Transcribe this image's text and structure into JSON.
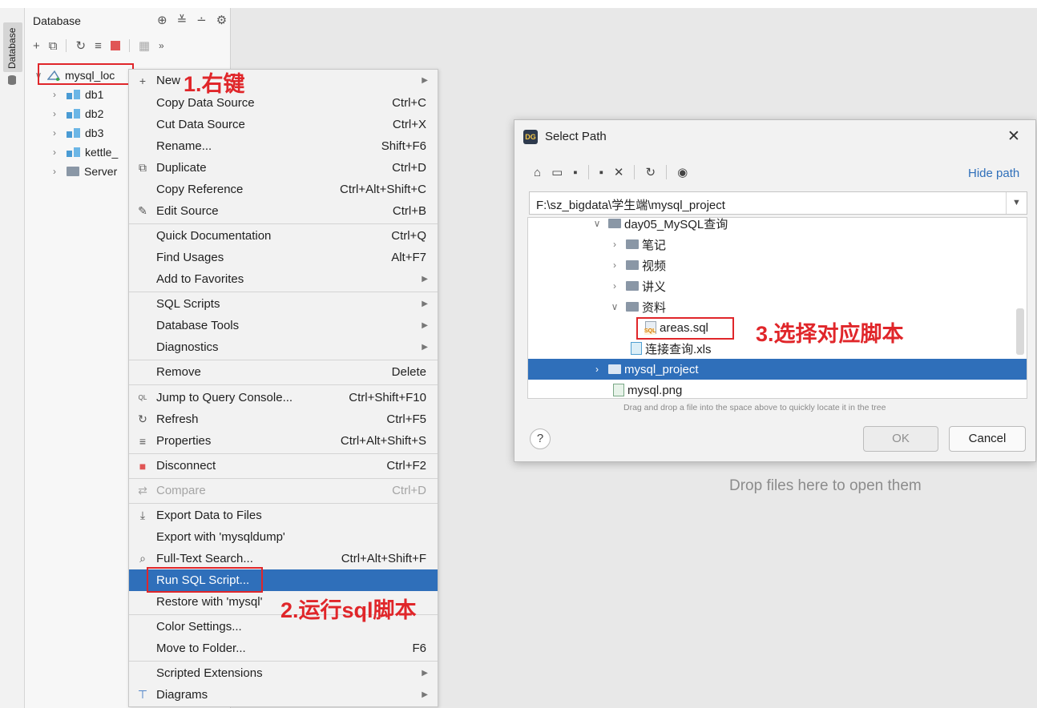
{
  "left_stripe": {
    "tab_label": "Database"
  },
  "panel": {
    "title": "Database"
  },
  "tree": [
    {
      "label": "mysql_loc",
      "icon": "mysql-connection-icon"
    },
    {
      "label": "db1",
      "icon": "database-icon"
    },
    {
      "label": "db2",
      "icon": "database-icon"
    },
    {
      "label": "db3",
      "icon": "database-icon"
    },
    {
      "label": "kettle_",
      "icon": "database-icon"
    },
    {
      "label": "Server",
      "icon": "folder-icon"
    }
  ],
  "context_menu": {
    "items": [
      {
        "icon": "+",
        "label": "New",
        "shortcut": "",
        "submenu": true
      },
      {
        "icon": "",
        "label": "Copy Data Source",
        "shortcut": "Ctrl+C"
      },
      {
        "icon": "",
        "label": "Cut Data Source",
        "shortcut": "Ctrl+X"
      },
      {
        "icon": "",
        "label": "Rename...",
        "shortcut": "Shift+F6"
      },
      {
        "icon": "⧉",
        "label": "Duplicate",
        "shortcut": "Ctrl+D"
      },
      {
        "icon": "",
        "label": "Copy Reference",
        "shortcut": "Ctrl+Alt+Shift+C"
      },
      {
        "icon": "✎",
        "label": "Edit Source",
        "shortcut": "Ctrl+B"
      },
      {
        "icon": "",
        "label": "Quick Documentation",
        "shortcut": "Ctrl+Q"
      },
      {
        "icon": "",
        "label": "Find Usages",
        "shortcut": "Alt+F7"
      },
      {
        "icon": "",
        "label": "Add to Favorites",
        "shortcut": "",
        "submenu": true
      },
      {
        "icon": "",
        "label": "SQL Scripts",
        "shortcut": "",
        "submenu": true
      },
      {
        "icon": "",
        "label": "Database Tools",
        "shortcut": "",
        "submenu": true
      },
      {
        "icon": "",
        "label": "Diagnostics",
        "shortcut": "",
        "submenu": true
      },
      {
        "icon": "",
        "label": "Remove",
        "shortcut": "Delete"
      },
      {
        "icon": "QL",
        "label": "Jump to Query Console...",
        "shortcut": "Ctrl+Shift+F10"
      },
      {
        "icon": "↻",
        "label": "Refresh",
        "shortcut": "Ctrl+F5"
      },
      {
        "icon": "≡",
        "label": "Properties",
        "shortcut": "Ctrl+Alt+Shift+S"
      },
      {
        "icon": "■",
        "label": "Disconnect",
        "shortcut": "Ctrl+F2"
      },
      {
        "icon": "⇄",
        "label": "Compare",
        "shortcut": "Ctrl+D",
        "disabled": true
      },
      {
        "icon": "⤓",
        "label": "Export Data to Files",
        "shortcut": ""
      },
      {
        "icon": "",
        "label": "Export with 'mysqldump'",
        "shortcut": ""
      },
      {
        "icon": "⌕",
        "label": "Full-Text Search...",
        "shortcut": "Ctrl+Alt+Shift+F"
      },
      {
        "icon": "",
        "label": "Run SQL Script...",
        "shortcut": "",
        "selected": true
      },
      {
        "icon": "",
        "label": "Restore with 'mysql'",
        "shortcut": ""
      },
      {
        "icon": "",
        "label": "Color Settings...",
        "shortcut": ""
      },
      {
        "icon": "",
        "label": "Move to Folder...",
        "shortcut": "F6"
      },
      {
        "icon": "",
        "label": "Scripted Extensions",
        "shortcut": "",
        "submenu": true
      },
      {
        "icon": "⊤",
        "label": "Diagrams",
        "shortcut": "",
        "submenu": true
      }
    ]
  },
  "annotations": {
    "step1": "1.右键",
    "step2": "2.运行sql脚本",
    "step3": "3.选择对应脚本"
  },
  "dialog": {
    "title": "Select Path",
    "logo": "DG",
    "hide_path": "Hide path",
    "path_value": "F:\\sz_bigdata\\学生端\\mysql_project",
    "tree": [
      {
        "label": "day05_MySQL查询",
        "type": "folder",
        "chevron": "open"
      },
      {
        "label": "笔记",
        "type": "folder",
        "chevron": "closed"
      },
      {
        "label": "视频",
        "type": "folder",
        "chevron": "closed"
      },
      {
        "label": "讲义",
        "type": "folder",
        "chevron": "closed"
      },
      {
        "label": "资料",
        "type": "folder",
        "chevron": "open"
      },
      {
        "label": "areas.sql",
        "type": "sql",
        "chevron": ""
      },
      {
        "label": "连接查询.xls",
        "type": "xls",
        "chevron": ""
      },
      {
        "label": "mysql_project",
        "type": "folder",
        "chevron": "closed",
        "selected": true
      },
      {
        "label": "mysql.png",
        "type": "png",
        "chevron": ""
      }
    ],
    "hint": "Drag and drop a file into the space above to quickly locate it in the tree",
    "help_label": "?",
    "ok_label": "OK",
    "cancel_label": "Cancel"
  },
  "editor": {
    "drop_hint": "Drop files here to open them"
  },
  "colors": {
    "selection": "#2f6fba",
    "annotation": "#e0262a"
  }
}
